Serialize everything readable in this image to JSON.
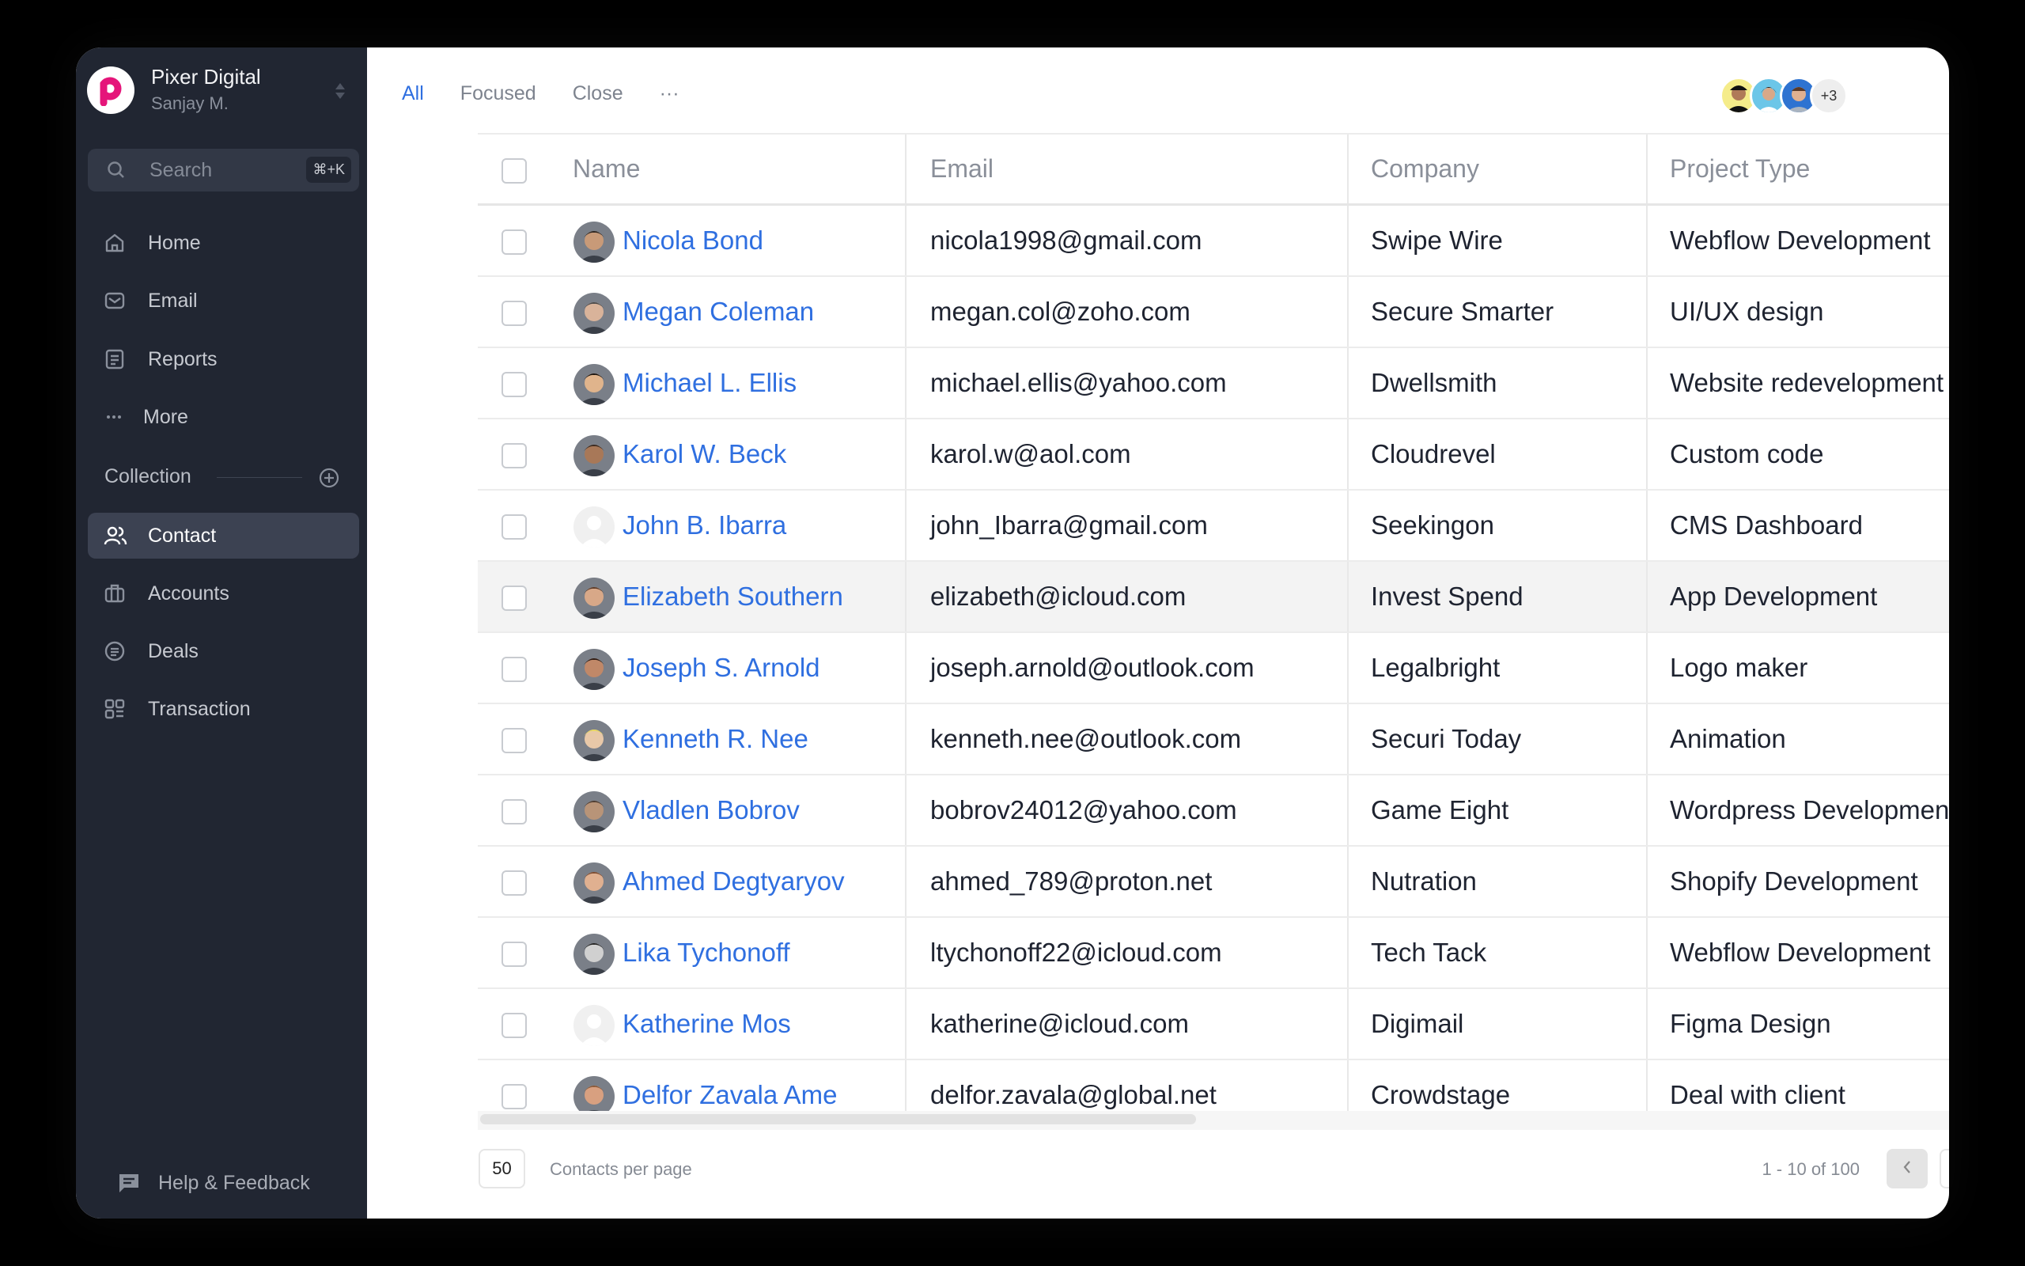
{
  "sidebar": {
    "org_name": "Pixer Digital",
    "user_name": "Sanjay M.",
    "logo_letter": "p",
    "search_placeholder": "Search",
    "search_shortcut": "⌘+K",
    "nav": [
      {
        "label": "Home",
        "icon": "home-icon"
      },
      {
        "label": "Email",
        "icon": "mail-icon"
      },
      {
        "label": "Reports",
        "icon": "reports-icon"
      },
      {
        "label": "More",
        "icon": "more-icon"
      }
    ],
    "collection_label": "Collection",
    "collection": [
      {
        "label": "Contact",
        "icon": "users-icon",
        "active": true
      },
      {
        "label": "Accounts",
        "icon": "briefcase-icon"
      },
      {
        "label": "Deals",
        "icon": "deals-icon"
      },
      {
        "label": "Transaction",
        "icon": "transaction-icon"
      }
    ],
    "help_label": "Help & Feedback"
  },
  "header": {
    "tabs": [
      "All",
      "Focused",
      "Close",
      "···"
    ],
    "active_tab": "All",
    "avatar_extra": "+3"
  },
  "table": {
    "columns": [
      "Name",
      "Email",
      "Company",
      "Project Type"
    ],
    "rows": [
      {
        "name": "Nicola Bond",
        "email": "nicola1998@gmail.com",
        "company": "Swipe Wire",
        "project": "Webflow Development",
        "skin": "#c89a78",
        "hair": "#2a2420"
      },
      {
        "name": "Megan Coleman",
        "email": "megan.col@zoho.com",
        "company": "Secure Smarter",
        "project": "UI/UX design",
        "skin": "#d9b39a",
        "hair": "#4a4a4a"
      },
      {
        "name": "Michael L. Ellis",
        "email": "michael.ellis@yahoo.com",
        "company": "Dwellsmith",
        "project": "Website redevelopment",
        "skin": "#e0b48c",
        "hair": "#1a1410"
      },
      {
        "name": "Karol W. Beck",
        "email": "karol.w@aol.com",
        "company": "Cloudrevel",
        "project": "Custom code",
        "skin": "#a87858",
        "hair": "#3a2a20"
      },
      {
        "name": "John B. Ibarra",
        "email": "john_Ibarra@gmail.com",
        "company": "Seekingon",
        "project": "CMS Dashboard",
        "skin": "#ffffff",
        "hair": "#e5e5e5",
        "placeholder": true
      },
      {
        "name": "Elizabeth Southern",
        "email": "elizabeth@icloud.com",
        "company": "Invest Spend",
        "project": "App Development",
        "skin": "#d8a888",
        "hair": "#5a3a28",
        "highlight": true
      },
      {
        "name": "Joseph S. Arnold",
        "email": "joseph.arnold@outlook.com",
        "company": "Legalbright",
        "project": "Logo maker",
        "skin": "#c08868",
        "hair": "#2a1a14"
      },
      {
        "name": "Kenneth R. Nee",
        "email": "kenneth.nee@outlook.com",
        "company": "Securi Today",
        "project": "Animation",
        "skin": "#e8c8a8",
        "hair": "#e8d860"
      },
      {
        "name": "Vladlen Bobrov",
        "email": "bobrov24012@yahoo.com",
        "company": "Game Eight",
        "project": "Wordpress Development",
        "skin": "#b89478",
        "hair": "#4a3a30"
      },
      {
        "name": "Ahmed Degtyaryov",
        "email": "ahmed_789@proton.net",
        "company": "Nutration",
        "project": "Shopify Development",
        "skin": "#e0b090",
        "hair": "#7a4a30"
      },
      {
        "name": "Lika Tychonoff",
        "email": "ltychonoff22@icloud.com",
        "company": "Tech Tack",
        "project": "Webflow Development",
        "skin": "#d0d0d0",
        "hair": "#222222"
      },
      {
        "name": "Katherine Mos",
        "email": "katherine@icloud.com",
        "company": "Digimail",
        "project": "Figma Design",
        "skin": "#ffffff",
        "hair": "#e5e5e5",
        "placeholder": true
      },
      {
        "name": "Delfor Zavala Ame",
        "email": "delfor.zavala@global.net",
        "company": "Crowdstage",
        "project": "Deal with client",
        "skin": "#d8a080",
        "hair": "#8a5a3a"
      }
    ]
  },
  "footer": {
    "per_page": "50",
    "per_page_label": "Contacts per page",
    "range": "1 - 10 of 100"
  },
  "colors": {
    "accent": "#2f6fe0",
    "sidebar": "#212632",
    "brand": "#e5157a"
  }
}
